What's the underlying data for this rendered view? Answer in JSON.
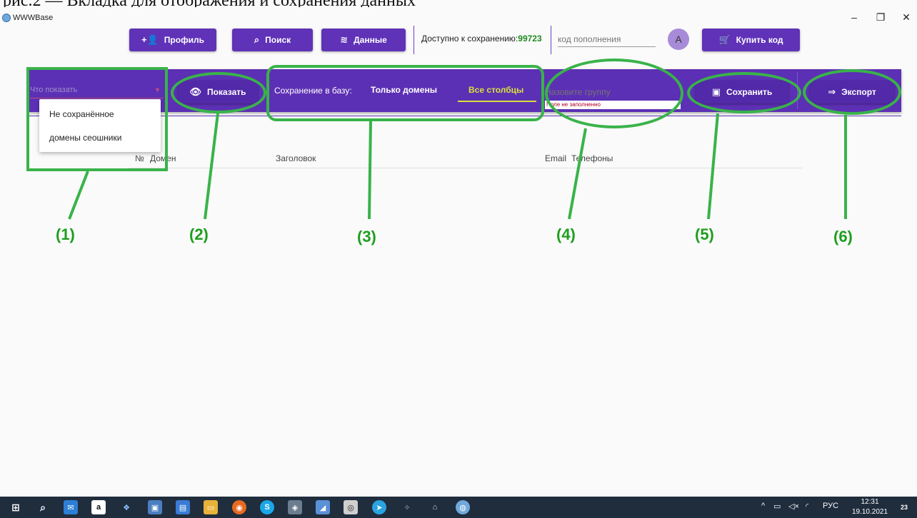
{
  "caption": "рис.2 — Вкладка для отображения и сохранения данных",
  "window": {
    "title": "WWWBase",
    "minimize": "–",
    "maximize": "❐",
    "close": "✕"
  },
  "nav": {
    "profile": "Профиль",
    "search": "Поиск",
    "data": "Данные",
    "available_label": "Доступно к сохранению:",
    "available_value": "99723",
    "code_placeholder": "код пополнения",
    "avatar_letter": "A",
    "buy": "Купить код"
  },
  "toolbar": {
    "select_placeholder": "Что показать",
    "dropdown_options": [
      "Не сохранённое",
      "домены сеошники"
    ],
    "show": "Показать",
    "save_label": "Сохранение в базу:",
    "only_domains": "Только домены",
    "all_columns": "Все столбцы",
    "group_placeholder": "Назовите группу",
    "group_error": "Поле не заполненно",
    "save": "Сохранить",
    "export": "Экспорт"
  },
  "table": {
    "columns": [
      "№",
      "Домен",
      "Заголовок",
      "Email",
      "Телефоны"
    ]
  },
  "annotations": [
    "(1)",
    "(2)",
    "(3)",
    "(4)",
    "(5)",
    "(6)"
  ],
  "taskbar": {
    "language": "РУС",
    "time": "12:31",
    "date": "19.10.2021",
    "notifications": "23"
  },
  "colors": {
    "primary": "#5c30b4",
    "accent": "#d6e13f",
    "annotation": "#39b34a",
    "counter": "#1f8a1f"
  }
}
